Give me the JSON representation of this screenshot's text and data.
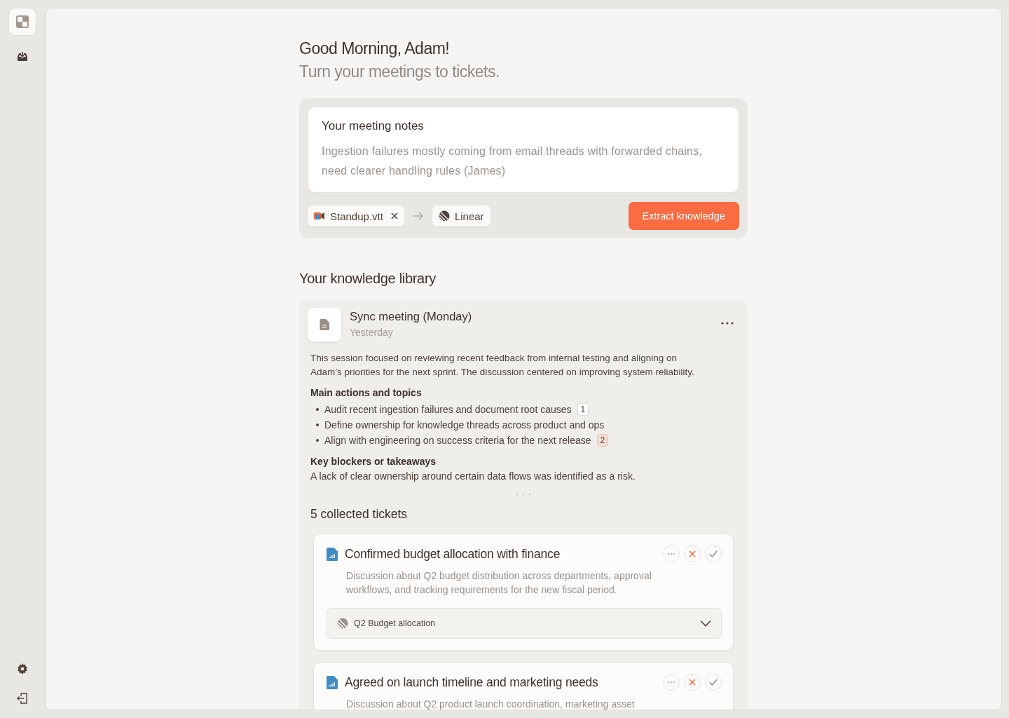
{
  "greeting": "Good Morning, Adam!",
  "subtitle": "Turn your meetings to tickets.",
  "notes": {
    "title": "Your meeting notes",
    "value": "Ingestion failures mostly coming from email threads with forwarded chains, need clearer handling rules (James)"
  },
  "source_file": "Standup.vtt",
  "destination": "Linear",
  "extract_button": "Extract knowledge",
  "library_title": "Your knowledge library",
  "meeting": {
    "title": "Sync meeting (Monday)",
    "date": "Yesterday",
    "summary": "This session focused on reviewing recent feedback from internal testing and aligning on Adam’s priorities for the next sprint. The discussion centered on improving system reliability.",
    "sections": [
      {
        "heading": "Main actions and topics",
        "kind": "list",
        "items": [
          {
            "text": "Audit recent ingestion failures and document root causes",
            "badge": "1",
            "highlighted": false
          },
          {
            "text": "Define ownership for knowledge threads across product and ops"
          },
          {
            "text": "Align with engineering on success criteria for the next release",
            "badge": "2",
            "highlighted": true
          }
        ]
      },
      {
        "heading": "Key blockers or takeaways",
        "kind": "paragraph",
        "text": "A lack of clear ownership around certain data flows was identified as a risk."
      }
    ]
  },
  "tickets_title": "5 collected tickets",
  "tickets": [
    {
      "title": "Confirmed budget allocation with finance",
      "description": "Discussion about Q2 budget distribution across departments, approval workflows, and tracking requirements for the new fiscal period.",
      "project": "Q2 Budget allocation"
    },
    {
      "title": "Agreed on launch timeline and marketing needs",
      "description": "Discussion about Q2 product launch coordination, marketing asset"
    }
  ]
}
